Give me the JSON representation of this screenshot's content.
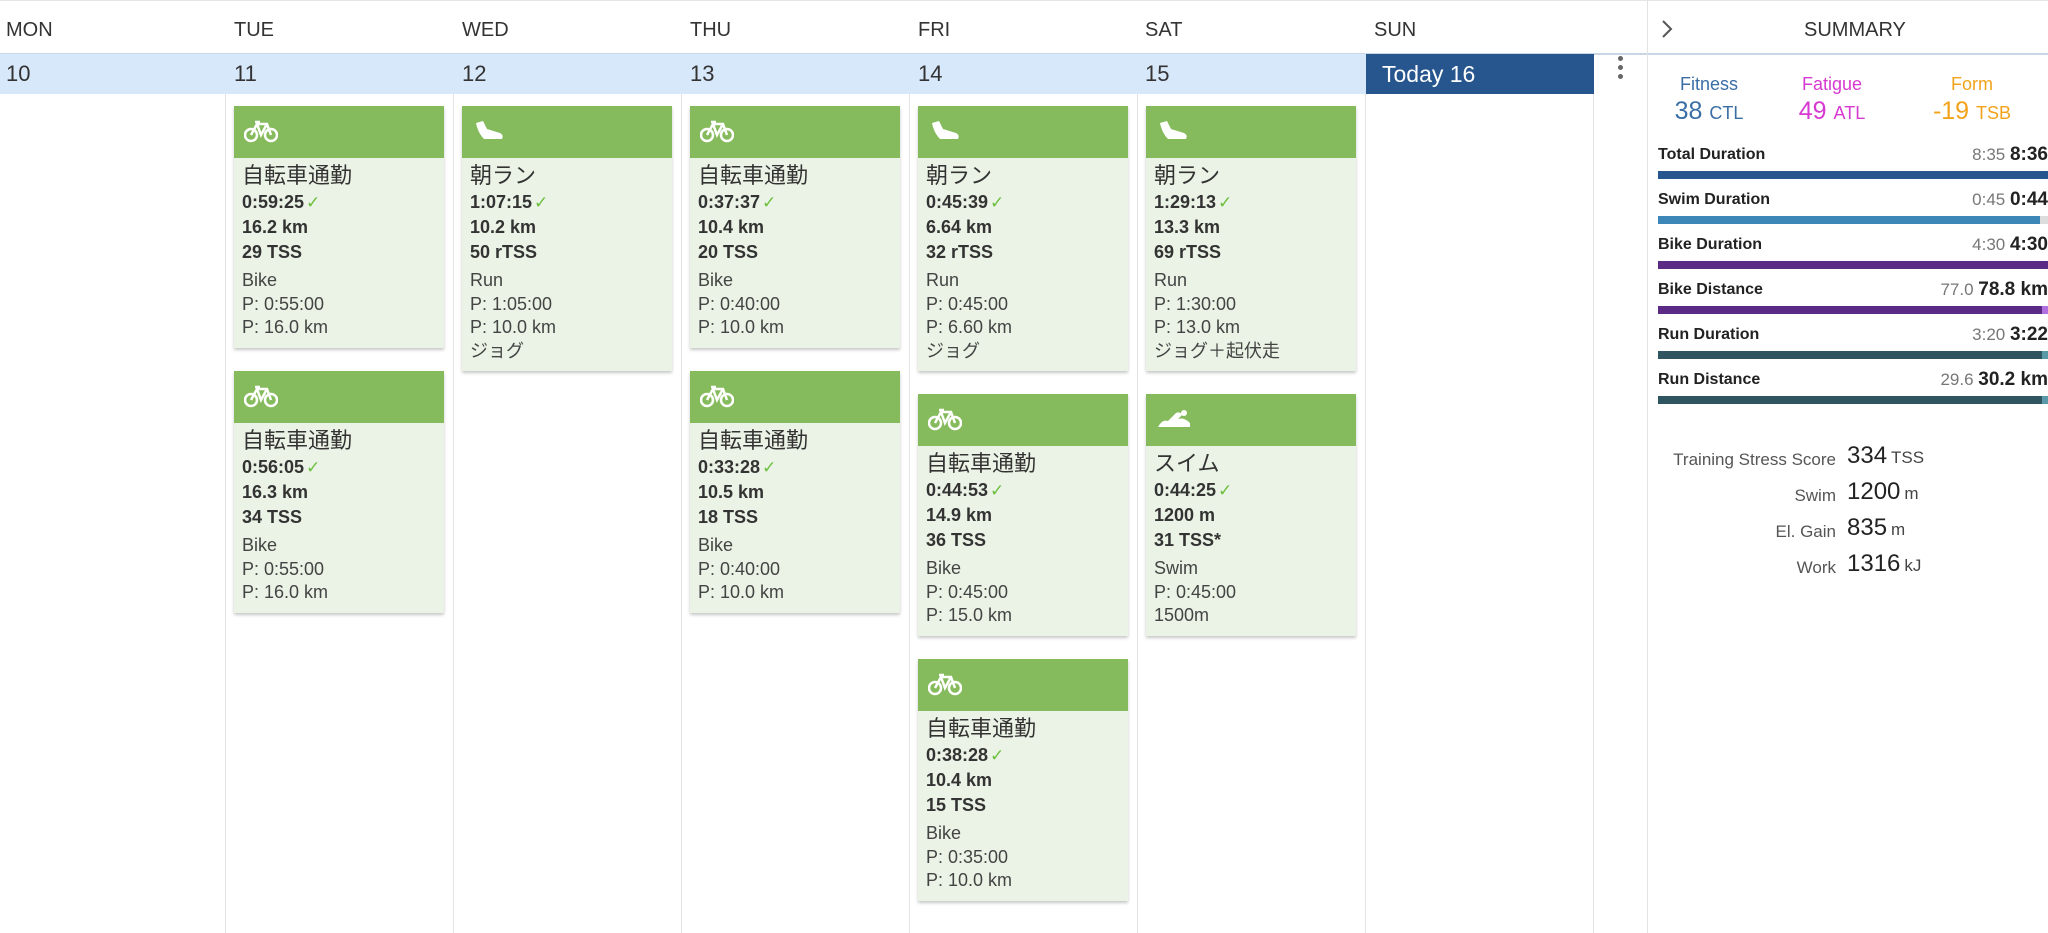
{
  "calendar": {
    "days": [
      {
        "name": "MON",
        "date": "10"
      },
      {
        "name": "TUE",
        "date": "11"
      },
      {
        "name": "WED",
        "date": "12"
      },
      {
        "name": "THU",
        "date": "13"
      },
      {
        "name": "FRI",
        "date": "14"
      },
      {
        "name": "SAT",
        "date": "15"
      },
      {
        "name": "SUN",
        "date": "Today 16"
      }
    ],
    "cards": {
      "tue1": {
        "icon": "bike-icon",
        "title": "自転車通勤",
        "duration": "0:59:25",
        "distance": "16.2 km",
        "tss": "29 TSS",
        "sport": "Bike",
        "plan1": "P: 0:55:00",
        "plan2": "P: 16.0 km"
      },
      "tue2": {
        "icon": "bike-icon",
        "title": "自転車通勤",
        "duration": "0:56:05",
        "distance": "16.3 km",
        "tss": "34 TSS",
        "sport": "Bike",
        "plan1": "P: 0:55:00",
        "plan2": "P: 16.0 km"
      },
      "wed1": {
        "icon": "run-shoe-icon",
        "title": "朝ラン",
        "duration": "1:07:15",
        "distance": "10.2 km",
        "tss": "50 rTSS",
        "sport": "Run",
        "plan1": "P: 1:05:00",
        "plan2": "P: 10.0 km",
        "note": "ジョグ"
      },
      "thu1": {
        "icon": "bike-icon",
        "title": "自転車通勤",
        "duration": "0:37:37",
        "distance": "10.4 km",
        "tss": "20 TSS",
        "sport": "Bike",
        "plan1": "P: 0:40:00",
        "plan2": "P: 10.0 km"
      },
      "thu2": {
        "icon": "bike-icon",
        "title": "自転車通勤",
        "duration": "0:33:28",
        "distance": "10.5 km",
        "tss": "18 TSS",
        "sport": "Bike",
        "plan1": "P: 0:40:00",
        "plan2": "P: 10.0 km"
      },
      "fri1": {
        "icon": "run-shoe-icon",
        "title": "朝ラン",
        "duration": "0:45:39",
        "distance": "6.64 km",
        "tss": "32 rTSS",
        "sport": "Run",
        "plan1": "P: 0:45:00",
        "plan2": "P: 6.60 km",
        "note": "ジョグ"
      },
      "fri2": {
        "icon": "bike-icon",
        "title": "自転車通勤",
        "duration": "0:44:53",
        "distance": "14.9 km",
        "tss": "36 TSS",
        "sport": "Bike",
        "plan1": "P: 0:45:00",
        "plan2": "P: 15.0 km"
      },
      "fri3": {
        "icon": "bike-icon",
        "title": "自転車通勤",
        "duration": "0:38:28",
        "distance": "10.4 km",
        "tss": "15 TSS",
        "sport": "Bike",
        "plan1": "P: 0:35:00",
        "plan2": "P: 10.0 km"
      },
      "sat1": {
        "icon": "run-shoe-icon",
        "title": "朝ラン",
        "duration": "1:29:13",
        "distance": "13.3 km",
        "tss": "69 rTSS",
        "sport": "Run",
        "plan1": "P: 1:30:00",
        "plan2": "P: 13.0 km",
        "note": "ジョグ＋起伏走"
      },
      "sat2": {
        "icon": "swim-icon",
        "title": "スイム",
        "duration": "0:44:25",
        "distance": "1200 m",
        "tss": "31 TSS*",
        "sport": "Swim",
        "plan1": "P: 0:45:00",
        "plan2": "1500m"
      }
    },
    "check_mark": "✓"
  },
  "summary": {
    "title": "SUMMARY",
    "fitness": {
      "label": "Fitness",
      "value": "38",
      "unit": "CTL",
      "color": "#3a6ea5"
    },
    "fatigue": {
      "label": "Fatigue",
      "value": "49",
      "unit": "ATL",
      "color": "#d63ad0"
    },
    "form": {
      "label": "Form",
      "value": "-19",
      "unit": "TSB",
      "color": "#f2a31b"
    },
    "progress": [
      {
        "label": "Total Duration",
        "planned": "8:35",
        "actual": "8:36",
        "ratio": 1.0,
        "color": "#27568f",
        "tip": ""
      },
      {
        "label": "Swim Duration",
        "planned": "0:45",
        "actual": "0:44",
        "ratio": 0.98,
        "color": "#3d86b8",
        "tip": ""
      },
      {
        "label": "Bike Duration",
        "planned": "4:30",
        "actual": "4:30",
        "ratio": 1.0,
        "color": "#5a2a84",
        "tip": ""
      },
      {
        "label": "Bike Distance",
        "planned": "77.0",
        "actual": "78.8 km",
        "ratio": 1.0,
        "color": "#5a2a84",
        "tip": "#b070e0"
      },
      {
        "label": "Run Duration",
        "planned": "3:20",
        "actual": "3:22",
        "ratio": 1.0,
        "color": "#2e5560",
        "tip": "#5a9aa8"
      },
      {
        "label": "Run Distance",
        "planned": "29.6",
        "actual": "30.2 km",
        "ratio": 1.0,
        "color": "#2e5560",
        "tip": "#5a9aa8"
      }
    ],
    "stats": [
      {
        "label": "Training Stress Score",
        "value": "334",
        "unit": "TSS"
      },
      {
        "label": "Swim",
        "value": "1200",
        "unit": "m"
      },
      {
        "label": "El. Gain",
        "value": "835",
        "unit": "m"
      },
      {
        "label": "Work",
        "value": "1316",
        "unit": "kJ"
      }
    ]
  }
}
